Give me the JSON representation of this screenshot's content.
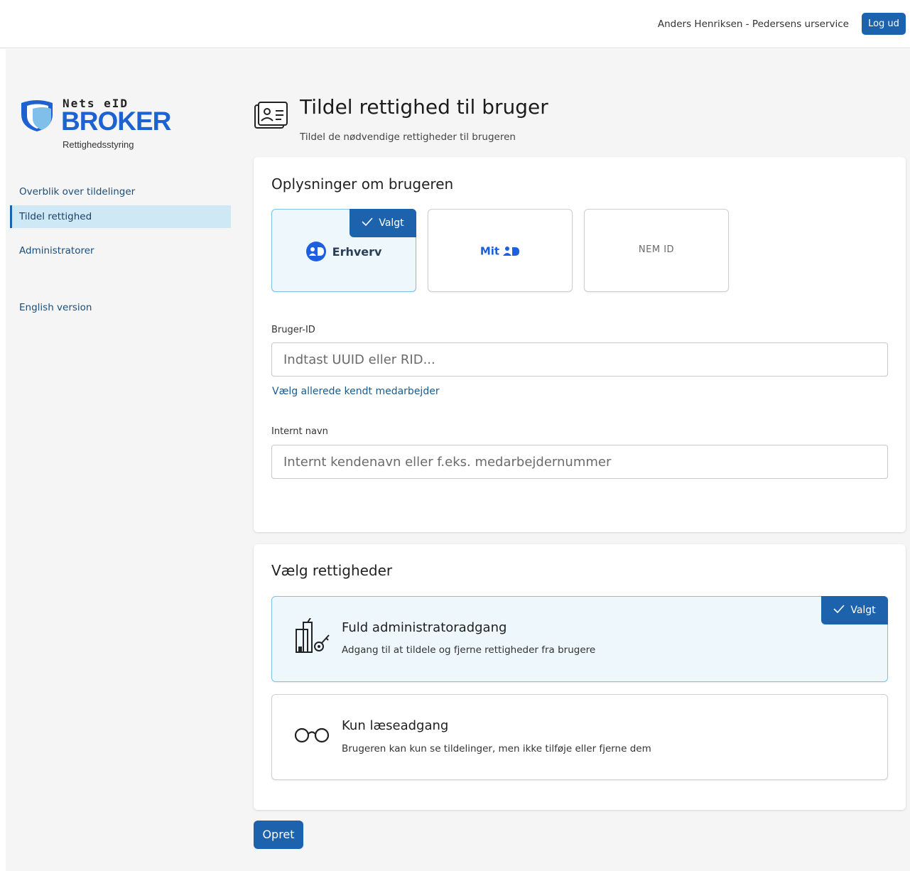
{
  "header": {
    "user": "Anders Henriksen - Pedersens urservice",
    "logout_label": "Log ud"
  },
  "logo": {
    "nets": "Nets eID",
    "broker": "BROKER",
    "subtitle": "Rettighedsstyring"
  },
  "sidebar": {
    "items": [
      {
        "label": "Overblik over tildelinger",
        "active": false
      },
      {
        "label": "Tildel rettighed",
        "active": true
      },
      {
        "label": "Administratorer",
        "active": false
      },
      {
        "label": "English version",
        "active": false
      }
    ]
  },
  "page": {
    "title": "Tildel rettighed til bruger",
    "subtitle": "Tildel de nødvendige rettigheder til brugeren"
  },
  "user_info": {
    "title": "Oplysninger om brugeren",
    "id_options": [
      {
        "label": "Erhverv",
        "selected": true,
        "icon": "mitid-erhverv-icon"
      },
      {
        "label": "Mit",
        "selected": false,
        "icon": "mitid-icon"
      },
      {
        "label": "NEM ID",
        "selected": false,
        "icon": "nemid-logo"
      }
    ],
    "selected_badge": "Valgt",
    "user_id_label": "Bruger-ID",
    "user_id_placeholder": "Indtast UUID eller RID...",
    "known_employee_link": "Vælg allerede kendt medarbejder",
    "internal_name_label": "Internt navn",
    "internal_name_placeholder": "Internt kendenavn eller f.eks. medarbejdernummer"
  },
  "permissions": {
    "title": "Vælg rettigheder",
    "selected_badge": "Valgt",
    "options": [
      {
        "title": "Fuld administratoradgang",
        "description": "Adgang til at tildele og fjerne rettigheder fra brugere",
        "selected": true,
        "icon": "admin-building-key-icon"
      },
      {
        "title": "Kun læseadgang",
        "description": "Brugeren kan kun se tildelinger, men ikke tilføje eller fjerne dem",
        "selected": false,
        "icon": "glasses-icon"
      }
    ]
  },
  "actions": {
    "create_label": "Opret"
  },
  "colors": {
    "primary": "#1d62ad",
    "selected_bg": "#edf7fc",
    "nav_active_bg": "#cfe8f6",
    "broker_blue": "#1d62d0"
  }
}
